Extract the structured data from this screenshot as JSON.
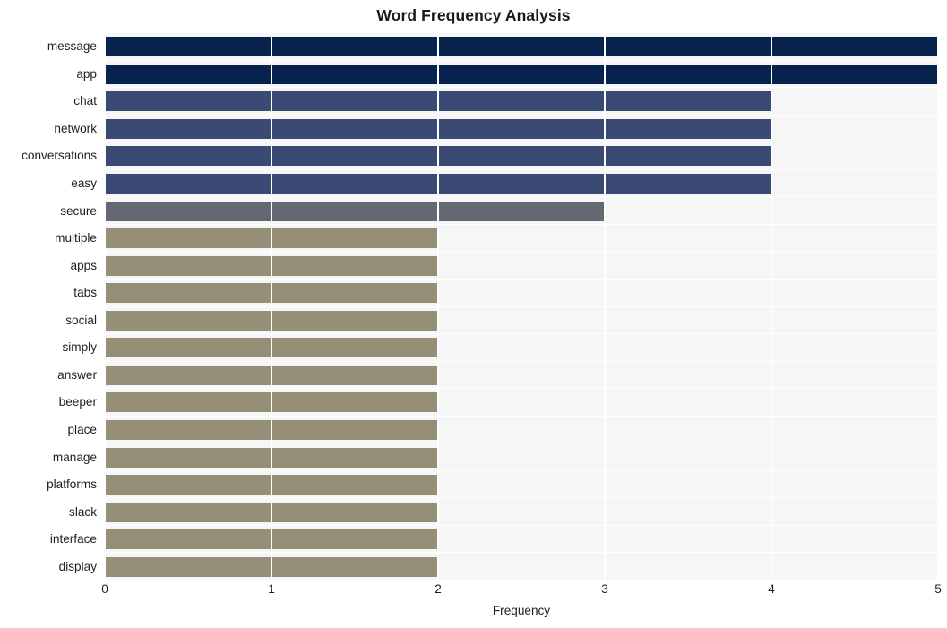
{
  "chart_data": {
    "type": "bar",
    "orientation": "horizontal",
    "title": "Word Frequency Analysis",
    "xlabel": "Frequency",
    "ylabel": "",
    "xlim": [
      0,
      5
    ],
    "xticks": [
      0,
      1,
      2,
      3,
      4,
      5
    ],
    "xtick_labels": [
      "0",
      "1",
      "2",
      "3",
      "4",
      "5"
    ],
    "grid": true,
    "legend": "none",
    "categories": [
      "message",
      "app",
      "chat",
      "network",
      "conversations",
      "easy",
      "secure",
      "multiple",
      "apps",
      "tabs",
      "social",
      "simply",
      "answer",
      "beeper",
      "place",
      "manage",
      "platforms",
      "slack",
      "interface",
      "display"
    ],
    "values": [
      5,
      5,
      4,
      4,
      4,
      4,
      3,
      2,
      2,
      2,
      2,
      2,
      2,
      2,
      2,
      2,
      2,
      2,
      2,
      2
    ],
    "bar_colors": [
      "#06224d",
      "#06224d",
      "#3a4a74",
      "#3a4a74",
      "#3a4a74",
      "#3a4a74",
      "#646873",
      "#968f77",
      "#968f77",
      "#968f77",
      "#968f77",
      "#968f77",
      "#968f77",
      "#968f77",
      "#968f77",
      "#968f77",
      "#968f77",
      "#968f77",
      "#968f77",
      "#968f77"
    ]
  },
  "style": {
    "plot_background": "#f6f6f7",
    "figure_background": "#ffffff",
    "gridline_color": "#ffffff",
    "text_color": "#1f1f1f",
    "title_color": "#1a1a1a"
  }
}
